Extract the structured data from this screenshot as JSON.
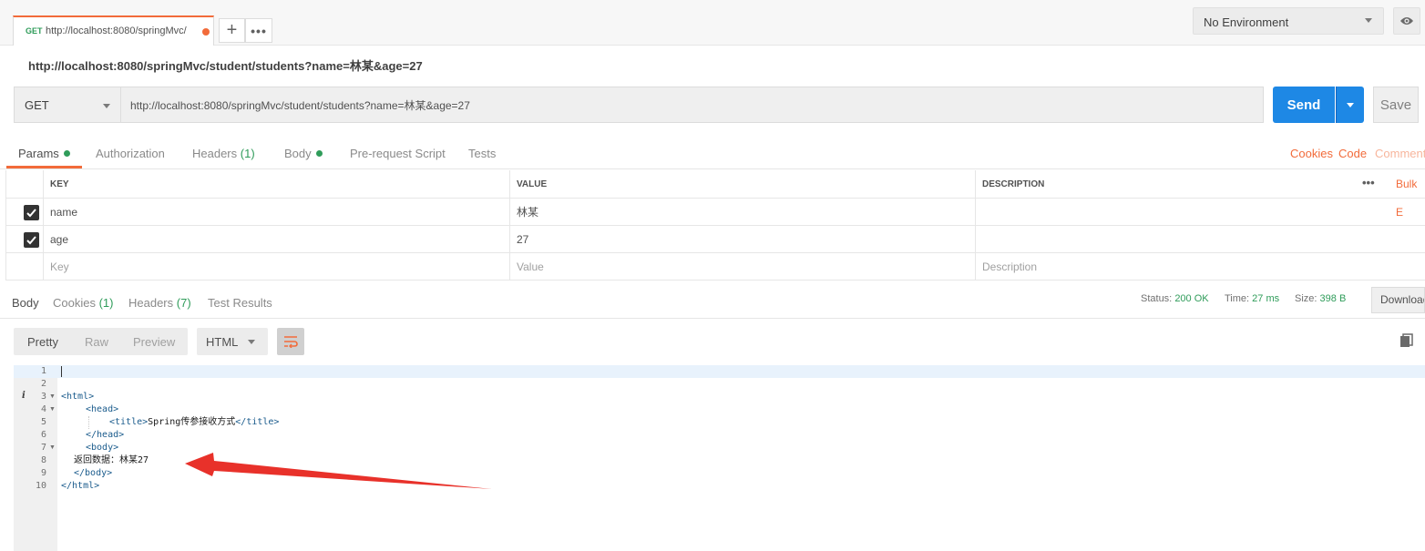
{
  "tab": {
    "method": "GET",
    "title": "http://localhost:8080/springMvc/"
  },
  "environment": {
    "selected": "No Environment"
  },
  "request": {
    "name": "http://localhost:8080/springMvc/student/students?name=林某&age=27",
    "method": "GET",
    "url": "http://localhost:8080/springMvc/student/students?name=林某&age=27",
    "send_label": "Send",
    "save_label": "Save"
  },
  "request_tabs": [
    {
      "label": "Params",
      "dot": true
    },
    {
      "label": "Authorization"
    },
    {
      "label": "Headers",
      "count": "(1)"
    },
    {
      "label": "Body",
      "dot": true
    },
    {
      "label": "Pre-request Script"
    },
    {
      "label": "Tests"
    }
  ],
  "right_links": {
    "cookies": "Cookies",
    "code": "Code",
    "comments": "Comment"
  },
  "params": {
    "headers": {
      "key": "KEY",
      "value": "VALUE",
      "description": "DESCRIPTION",
      "bulk_edit": "Bulk E"
    },
    "rows": [
      {
        "key": "name",
        "value": "林某",
        "checked": true
      },
      {
        "key": "age",
        "value": "27",
        "checked": true
      }
    ],
    "placeholder": {
      "key": "Key",
      "value": "Value",
      "description": "Description"
    }
  },
  "response_tabs": [
    {
      "label": "Body"
    },
    {
      "label": "Cookies",
      "count": "(1)"
    },
    {
      "label": "Headers",
      "count": "(7)"
    },
    {
      "label": "Test Results"
    }
  ],
  "response_status": {
    "status_label": "Status:",
    "status": "200 OK",
    "time_label": "Time:",
    "time": "27 ms",
    "size_label": "Size:",
    "size": "398 B",
    "download_label": "Download"
  },
  "view_modes": [
    "Pretty",
    "Raw",
    "Preview"
  ],
  "format": "HTML",
  "code": {
    "line_numbers": [
      "1",
      "2",
      "3",
      "4",
      "5",
      "6",
      "7",
      "8",
      "9",
      "10"
    ],
    "lines": [
      "",
      "",
      "<html>",
      "<head>",
      "<title>Spring传参接收方式</title>",
      "</head>",
      "<body>",
      "返回数据：林某27",
      "</body>",
      "</html>"
    ],
    "title_text": "Spring传参接收方式",
    "body_text": "返回数据：林某27"
  },
  "colors": {
    "accent": "#f26b3a",
    "send": "#1e88e5",
    "success": "#2f9c5a",
    "arrow": "#e8312a"
  }
}
